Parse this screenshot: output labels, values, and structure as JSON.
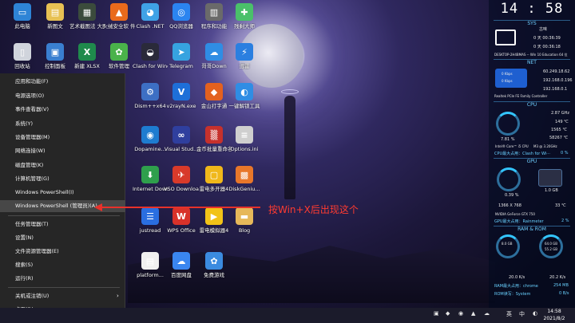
{
  "desktop": {
    "icons": [
      {
        "label": "此电脑",
        "color": "#2e84d6",
        "glyph": "▭"
      },
      {
        "label": "新图文",
        "color": "#e7c153",
        "glyph": "▤"
      },
      {
        "label": "艺术截图法 大图.png",
        "color": "#3b4b3c",
        "glyph": "▦"
      },
      {
        "label": "火绒安全软 件",
        "color": "#e96a1c",
        "glyph": "▲"
      },
      {
        "label": "Clash .NET",
        "color": "#3fa2e6",
        "glyph": "◕"
      },
      {
        "label": "QQ浏览器",
        "color": "#2b84f0",
        "glyph": "◎"
      },
      {
        "label": "程序和功能",
        "color": "#6a6a6a",
        "glyph": "▥"
      },
      {
        "label": "残剩大师",
        "color": "#4ac06a",
        "glyph": "✚"
      },
      {
        "label": "回收站",
        "color": "#d0d4dc",
        "glyph": "▯"
      },
      {
        "label": "控制面板",
        "color": "#3a7fd0",
        "glyph": "▣"
      },
      {
        "label": "新建 XLSX",
        "color": "#1f8a4c",
        "glyph": "X"
      },
      {
        "label": "软件管理",
        "color": "#4ab24a",
        "glyph": "✿"
      },
      {
        "label": "Clash for Windows...",
        "color": "#2a2a3a",
        "glyph": "◒"
      },
      {
        "label": "Telegram",
        "color": "#36a3e0",
        "glyph": "➤"
      },
      {
        "label": "哥哥Down",
        "color": "#2f8de4",
        "glyph": "☁"
      },
      {
        "label": "迅雷",
        "color": "#2b7fe0",
        "glyph": "⚡"
      },
      {
        "label": "Dism++x64",
        "color": "#3d6fc4",
        "glyph": "⚙"
      },
      {
        "label": "v2rayN.exe",
        "color": "#1e6fd8",
        "glyph": "V"
      },
      {
        "label": "金山打字通",
        "color": "#e3611f",
        "glyph": "◆"
      },
      {
        "label": "一键解锁工具",
        "color": "#2f8de4",
        "glyph": "◐"
      },
      {
        "label": "Dopamine...",
        "color": "#1e7cd0",
        "glyph": "◉"
      },
      {
        "label": "Visual Stud...",
        "color": "#2f3f9e",
        "glyph": "∞"
      },
      {
        "label": "金币批量重命名软件",
        "color": "#c6312c",
        "glyph": "▒"
      },
      {
        "label": "Options.ini",
        "color": "#cfcfcf",
        "glyph": "≡"
      },
      {
        "label": "Internet Downlo...",
        "color": "#2f9f4c",
        "glyph": "⬇"
      },
      {
        "label": "VSO Download...",
        "color": "#d83a2a",
        "glyph": "✈"
      },
      {
        "label": "雷电多开器4",
        "color": "#f0b81a",
        "glyph": "▢"
      },
      {
        "label": "DiskGeniu...",
        "color": "#e8772a",
        "glyph": "▩"
      },
      {
        "label": "justread",
        "color": "#2a6ee0",
        "glyph": "☰"
      },
      {
        "label": "WPS Office",
        "color": "#d8322a",
        "glyph": "W"
      },
      {
        "label": "雷电模拟器4",
        "color": "#f2c318",
        "glyph": "▶"
      },
      {
        "label": "Blog",
        "color": "#e6b85a",
        "glyph": "▬"
      },
      {
        "label": "platform...",
        "color": "#f0f0f0",
        "glyph": "▤"
      },
      {
        "label": "百度网盘",
        "color": "#3a86f0",
        "glyph": "☁"
      },
      {
        "label": "免费游戏",
        "color": "#3b8be0",
        "glyph": "✿"
      }
    ]
  },
  "start_menu": {
    "items": [
      "应用和功能(F)",
      "电源选项(O)",
      "事件查看器(V)",
      "系统(Y)",
      "设备管理器(M)",
      "网络连接(W)",
      "磁盘管理(K)",
      "计算机管理(G)",
      "Windows PowerShell(I)",
      "Windows PowerShell (管理员)(A)",
      "任务管理器(T)",
      "设置(N)",
      "文件资源管理器(E)",
      "搜索(S)",
      "运行(R)",
      "关机或注销(U)",
      "桌面(D)"
    ]
  },
  "annotation": {
    "text": "按Win+X后出现这个"
  },
  "widget": {
    "clock": "14 : 58",
    "sys_title": "SYS",
    "sys_user": "古味",
    "sys_time1": "0 天 00:36:39",
    "sys_time2": "0 天 00:36:18",
    "sys_machine": "DESKTOP-2H4BMAS -- Win 10 Education 64 位",
    "net_title": "NET",
    "net_ip1": "60.249.18.62",
    "net_ip2": "192.168.0.196",
    "net_ip3": "192.168.0.1",
    "net_up": "0 Kbps",
    "net_down": "0 Kbps",
    "net_adapter": "Realtek PCIe FE Family Controller",
    "cpu_title": "CPU",
    "cpu_freq": "2.87 GHz",
    "cpu_v1": "149 ℃",
    "cpu_v2": "1565 ℃",
    "cpu_v3": "58267 ℃",
    "cpu_load": "7.81 %",
    "cpu_name": "Intel® Core™ i5 CPU",
    "cpu_model": "M3 @ 3.20GHz",
    "cpu_top": "CPU最大占用：Clash for Wi···",
    "cpu_top_val": "0 %",
    "gpu_title": "GPU",
    "gpu_load": "0.39 %",
    "gpu_mem": "1.0 GB",
    "gpu_res": "1366 X 768",
    "gpu_temp": "33 ℃",
    "gpu_name": "NVIDIA GeForce GTX 750",
    "gpu_top": "GPU最大占用：Rainmeter",
    "gpu_top_val": "2 %",
    "ram_title": "RAM & ROM",
    "ram_a": "8.0 GB",
    "ram_b": "64.0 GB",
    "ram_c": "55.2 GB",
    "net_speed_up": "20.0 K/s",
    "net_speed_down": "20.2 K/s",
    "ram_top": "RAM最大占用：chrome",
    "ram_top_val": "254 MB",
    "rom_top": "ROM读写：System",
    "rom_top_val": "0 B/s"
  },
  "taskbar": {
    "time": "14:58",
    "date": "2021/8/2",
    "ime": "中",
    "ime2": "英"
  },
  "colors": {
    "menu_bg": "#262626",
    "highlight": "#474747",
    "annotation": "#e8312a",
    "widget_accent": "#69d1ff"
  }
}
